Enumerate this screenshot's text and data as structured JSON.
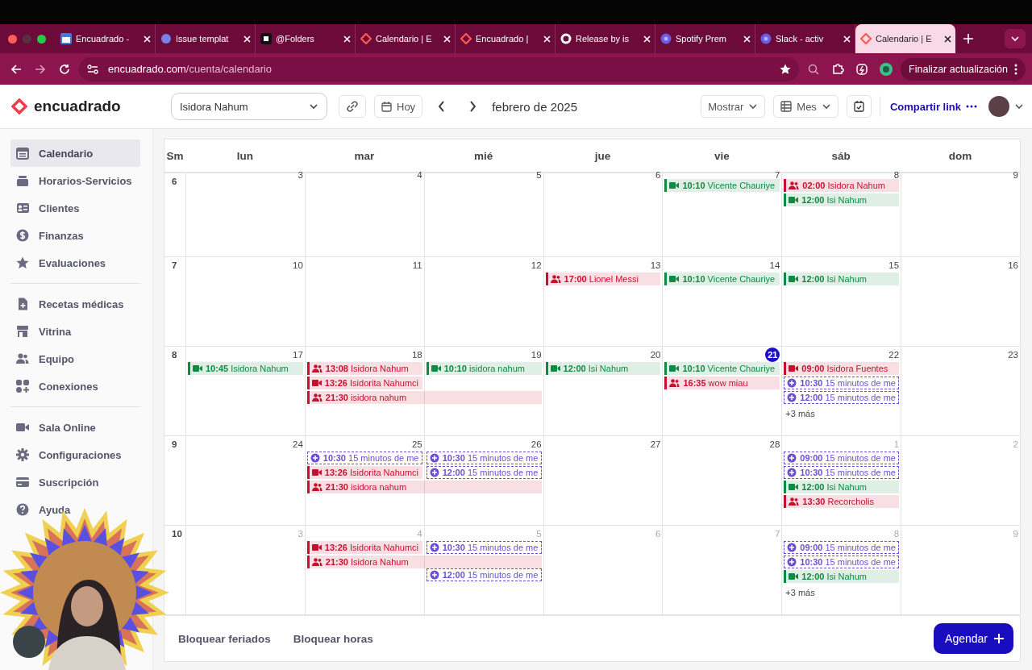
{
  "browser": {
    "tabs": [
      {
        "title": "Encuadrado -",
        "selected": false
      },
      {
        "title": "Issue templat",
        "selected": false
      },
      {
        "title": "@Folders",
        "selected": false
      },
      {
        "title": "Calendario | E",
        "selected": false
      },
      {
        "title": "Encuadrado |",
        "selected": false
      },
      {
        "title": "Release by is",
        "selected": false
      },
      {
        "title": "Spotify Prem",
        "selected": false
      },
      {
        "title": "Slack - activ",
        "selected": false
      },
      {
        "title": "Calendario | E",
        "selected": true
      }
    ],
    "url": {
      "domain": "encuadrado.com",
      "path": "/cuenta/calendario"
    },
    "update_button": "Finalizar actualización"
  },
  "header": {
    "logo": "encuadrado",
    "professional": "Isidora Nahum",
    "today": "Hoy",
    "month": "febrero de 2025",
    "show": "Mostrar",
    "view": "Mes",
    "share": "Compartir link"
  },
  "sidebar": {
    "groups": [
      [
        {
          "label": "Calendario",
          "selected": true
        },
        {
          "label": "Horarios-Servicios",
          "selected": false
        },
        {
          "label": "Clientes",
          "selected": false
        },
        {
          "label": "Finanzas",
          "selected": false
        },
        {
          "label": "Evaluaciones",
          "selected": false
        }
      ],
      [
        {
          "label": "Recetas médicas",
          "selected": false
        },
        {
          "label": "Vitrina",
          "selected": false
        },
        {
          "label": "Equipo",
          "selected": false
        },
        {
          "label": "Conexiones",
          "selected": false
        }
      ],
      [
        {
          "label": "Sala Online",
          "selected": false
        },
        {
          "label": "Configuraciones",
          "selected": false
        },
        {
          "label": "Suscripción",
          "selected": false
        },
        {
          "label": "Ayuda",
          "selected": false
        }
      ]
    ]
  },
  "calendar": {
    "columns": [
      "Sm",
      "lun",
      "mar",
      "mié",
      "jue",
      "vie",
      "sáb",
      "dom"
    ],
    "weeks": [
      {
        "number": "6",
        "days": [
          {
            "date": "3",
            "muted": false,
            "today": false
          },
          {
            "date": "4",
            "muted": false,
            "today": false
          },
          {
            "date": "5",
            "muted": false,
            "today": false
          },
          {
            "date": "6",
            "muted": false,
            "today": false
          },
          {
            "date": "7",
            "muted": false,
            "today": false,
            "events": [
              {
                "kind": "video",
                "color": "#0f8a43",
                "time": "10:10",
                "title": "Vicente Chauriye"
              }
            ]
          },
          {
            "date": "8",
            "muted": false,
            "today": false,
            "events": [
              {
                "kind": "group",
                "color": "#c8102e",
                "time": "02:00",
                "title": "Isidora Nahum"
              },
              {
                "kind": "video",
                "color": "#0f8a43",
                "time": "12:00",
                "title": "Isi Nahum"
              }
            ]
          },
          {
            "date": "9",
            "muted": false,
            "today": false
          }
        ]
      },
      {
        "number": "7",
        "days": [
          {
            "date": "10",
            "muted": false,
            "today": false
          },
          {
            "date": "11",
            "muted": false,
            "today": false
          },
          {
            "date": "12",
            "muted": false,
            "today": false
          },
          {
            "date": "13",
            "muted": false,
            "today": false,
            "events": [
              {
                "kind": "group",
                "color": "#c8102e",
                "time": "17:00",
                "title": "Lionel Messi"
              }
            ]
          },
          {
            "date": "14",
            "muted": false,
            "today": false,
            "events": [
              {
                "kind": "video",
                "color": "#0f8a43",
                "time": "10:10",
                "title": "Vicente Chauriye"
              }
            ]
          },
          {
            "date": "15",
            "muted": false,
            "today": false,
            "events": [
              {
                "kind": "video",
                "color": "#0f8a43",
                "time": "12:00",
                "title": "Isi Nahum"
              }
            ]
          },
          {
            "date": "16",
            "muted": false,
            "today": false
          }
        ]
      },
      {
        "number": "8",
        "days": [
          {
            "date": "17",
            "muted": false,
            "today": false,
            "events": [
              {
                "kind": "video",
                "color": "#0f8a43",
                "time": "10:45",
                "title": "Isidora Nahum"
              }
            ]
          },
          {
            "date": "18",
            "muted": false,
            "today": false,
            "events": [
              {
                "kind": "group",
                "color": "#c8102e",
                "time": "13:08",
                "title": "Isidora Nahum"
              },
              {
                "kind": "video",
                "color": "#c8102e",
                "time": "13:26",
                "title": "Isidorita Nahumci"
              },
              {
                "kind": "group",
                "color": "#c8102e",
                "time": "21:30",
                "title": "isidora nahum",
                "wide": true
              }
            ]
          },
          {
            "date": "19",
            "muted": false,
            "today": false,
            "events": [
              {
                "kind": "video",
                "color": "#0f8a43",
                "time": "10:10",
                "title": "isidora nahum"
              }
            ]
          },
          {
            "date": "20",
            "muted": false,
            "today": false,
            "events": [
              {
                "kind": "video",
                "color": "#0f8a43",
                "time": "12:00",
                "title": "Isi Nahum"
              }
            ]
          },
          {
            "date": "21",
            "muted": false,
            "today": true,
            "events": [
              {
                "kind": "video",
                "color": "#0f8a43",
                "time": "10:10",
                "title": "Vicente Chauriye"
              },
              {
                "kind": "group",
                "color": "#c8102e",
                "time": "16:35",
                "title": "wow miau"
              }
            ]
          },
          {
            "date": "22",
            "muted": false,
            "today": false,
            "events": [
              {
                "kind": "video",
                "color": "#c8102e",
                "time": "09:00",
                "title": "Isidora Fuentes"
              },
              {
                "kind": "slot",
                "color": "#6b4fd0",
                "time": "10:30",
                "title": "15 minutos de me"
              },
              {
                "kind": "slot",
                "color": "#6b4fd0",
                "time": "12:00",
                "title": "15 minutos de me"
              }
            ],
            "more": "+3 más"
          },
          {
            "date": "23",
            "muted": false,
            "today": false
          }
        ]
      },
      {
        "number": "9",
        "days": [
          {
            "date": "24",
            "muted": false,
            "today": false
          },
          {
            "date": "25",
            "muted": false,
            "today": false,
            "events": [
              {
                "kind": "slot",
                "color": "#6b4fd0",
                "time": "10:30",
                "title": "15 minutos de me"
              },
              {
                "kind": "video",
                "color": "#c8102e",
                "time": "13:26",
                "title": "Isidorita Nahumci"
              },
              {
                "kind": "group",
                "color": "#c8102e",
                "time": "21:30",
                "title": "isidora nahum",
                "wide": true
              }
            ]
          },
          {
            "date": "26",
            "muted": false,
            "today": false,
            "events": [
              {
                "kind": "slot",
                "color": "#6b4fd0",
                "time": "10:30",
                "title": "15 minutos de me"
              },
              {
                "kind": "slot",
                "color": "#6b4fd0",
                "time": "12:00",
                "title": "15 minutos de me"
              }
            ]
          },
          {
            "date": "27",
            "muted": false,
            "today": false
          },
          {
            "date": "28",
            "muted": false,
            "today": false
          },
          {
            "date": "1",
            "muted": true,
            "today": false,
            "events": [
              {
                "kind": "slot",
                "color": "#6b4fd0",
                "time": "09:00",
                "title": "15 minutos de me"
              },
              {
                "kind": "slot",
                "color": "#6b4fd0",
                "time": "10:30",
                "title": "15 minutos de me"
              },
              {
                "kind": "video",
                "color": "#0f8a43",
                "time": "12:00",
                "title": "Isi Nahum"
              },
              {
                "kind": "group",
                "color": "#c8102e",
                "time": "13:30",
                "title": "Recorcholis"
              }
            ]
          },
          {
            "date": "2",
            "muted": true,
            "today": false
          }
        ]
      },
      {
        "number": "10",
        "days": [
          {
            "date": "3",
            "muted": true,
            "today": false
          },
          {
            "date": "4",
            "muted": true,
            "today": false,
            "events": [
              {
                "kind": "video",
                "color": "#c8102e",
                "time": "13:26",
                "title": "Isidorita Nahumci"
              },
              {
                "kind": "group",
                "color": "#c8102e",
                "time": "21:30",
                "title": "Isidora Nahum",
                "wide": true
              }
            ]
          },
          {
            "date": "5",
            "muted": true,
            "today": false,
            "events": [
              {
                "kind": "slot",
                "color": "#6b4fd0",
                "time": "10:30",
                "title": "15 minutos de me"
              },
              {
                "kind": "slot",
                "color": "#6b4fd0",
                "time": "12:00",
                "title": "15 minutos de me"
              }
            ]
          },
          {
            "date": "6",
            "muted": true,
            "today": false
          },
          {
            "date": "7",
            "muted": true,
            "today": false
          },
          {
            "date": "8",
            "muted": true,
            "today": false,
            "events": [
              {
                "kind": "slot",
                "color": "#6b4fd0",
                "time": "09:00",
                "title": "15 minutos de me"
              },
              {
                "kind": "slot",
                "color": "#6b4fd0",
                "time": "10:30",
                "title": "15 minutos de me"
              },
              {
                "kind": "video",
                "color": "#0f8a43",
                "time": "12:00",
                "title": "Isi Nahum"
              }
            ],
            "more": "+3 más"
          },
          {
            "date": "9",
            "muted": true,
            "today": false
          }
        ]
      }
    ]
  },
  "footer": {
    "actions": [
      "Bloquear feriados",
      "Bloquear horas"
    ],
    "primary": "Agendar"
  }
}
